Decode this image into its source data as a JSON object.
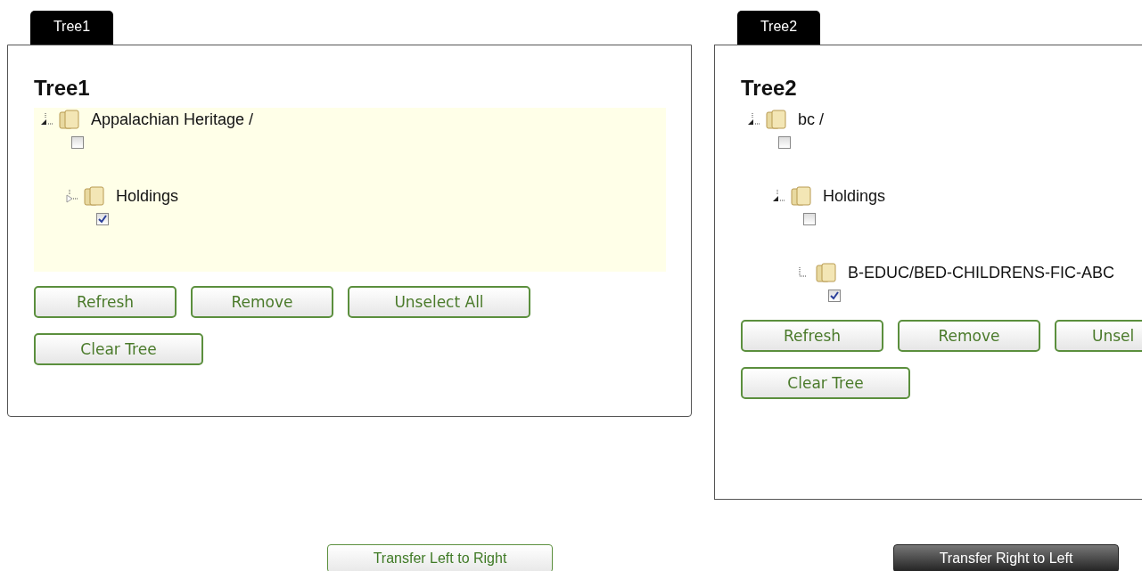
{
  "panels": [
    {
      "tab": "Tree1",
      "title": "Tree1",
      "highlighted": true,
      "clipped": false,
      "nodes": [
        {
          "label": "Appalachian Heritage /",
          "expanded": true,
          "checked": false,
          "children": [
            {
              "label": "Holdings",
              "expanded": false,
              "checked": true
            }
          ]
        }
      ],
      "buttons": [
        "Refresh",
        "Remove",
        "Unselect All",
        "Clear Tree"
      ]
    },
    {
      "tab": "Tree2",
      "title": "Tree2",
      "highlighted": false,
      "clipped": true,
      "nodes": [
        {
          "label": "bc /",
          "expanded": true,
          "checked": false,
          "children": [
            {
              "label": "Holdings",
              "expanded": true,
              "checked": false,
              "children": [
                {
                  "label": "B-EDUC/BED-CHILDRENS-FIC-ABC",
                  "checked": true
                }
              ]
            }
          ]
        }
      ],
      "buttons": [
        "Refresh",
        "Remove",
        "Unsel",
        "Clear Tree"
      ]
    }
  ],
  "transfer": [
    {
      "label": "Transfer Left to Right",
      "selected": false
    },
    {
      "label": "Transfer Right to Left",
      "selected": true
    }
  ]
}
